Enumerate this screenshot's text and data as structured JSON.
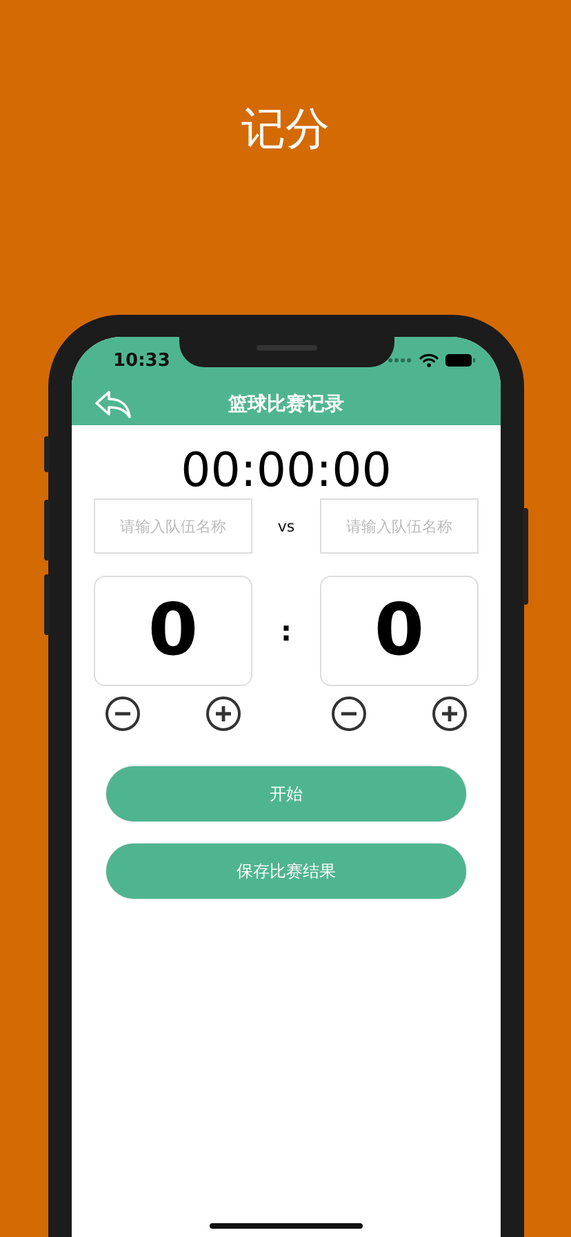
{
  "promo_title": "记分",
  "status_bar": {
    "time": "10:33"
  },
  "nav": {
    "title": "篮球比赛记录"
  },
  "timer": "00:00:00",
  "teams": [
    {
      "placeholder": "请输入队伍名称",
      "score": "0"
    },
    {
      "placeholder": "请输入队伍名称",
      "score": "0"
    }
  ],
  "vs": "vs",
  "separator": ":",
  "buttons": [
    "开始",
    "保存比赛结果"
  ]
}
